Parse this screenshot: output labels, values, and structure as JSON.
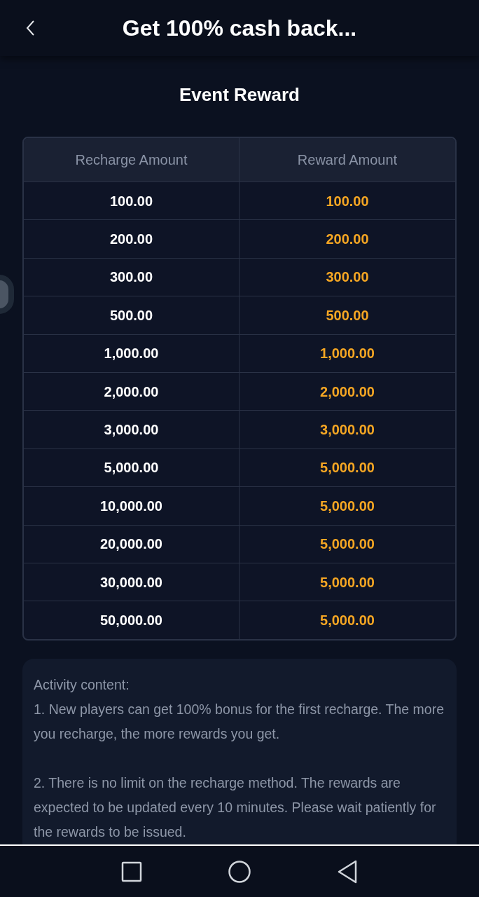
{
  "header": {
    "title": "Get 100% cash back..."
  },
  "section_title": "Event Reward",
  "table": {
    "columns": [
      "Recharge Amount",
      "Reward Amount"
    ],
    "rows": [
      [
        "100.00",
        "100.00"
      ],
      [
        "200.00",
        "200.00"
      ],
      [
        "300.00",
        "300.00"
      ],
      [
        "500.00",
        "500.00"
      ],
      [
        "1,000.00",
        "1,000.00"
      ],
      [
        "2,000.00",
        "2,000.00"
      ],
      [
        "3,000.00",
        "3,000.00"
      ],
      [
        "5,000.00",
        "5,000.00"
      ],
      [
        "10,000.00",
        "5,000.00"
      ],
      [
        "20,000.00",
        "5,000.00"
      ],
      [
        "30,000.00",
        "5,000.00"
      ],
      [
        "50,000.00",
        "5,000.00"
      ]
    ]
  },
  "activity": {
    "heading": "Activity content:",
    "paragraphs": [
      "1. New players can get 100% bonus for the first recharge. The more you recharge, the more rewards you get.",
      "2. There is no limit on the recharge method. The rewards are expected to be updated every 10 minutes. Please wait patiently for the rewards to be issued."
    ]
  }
}
